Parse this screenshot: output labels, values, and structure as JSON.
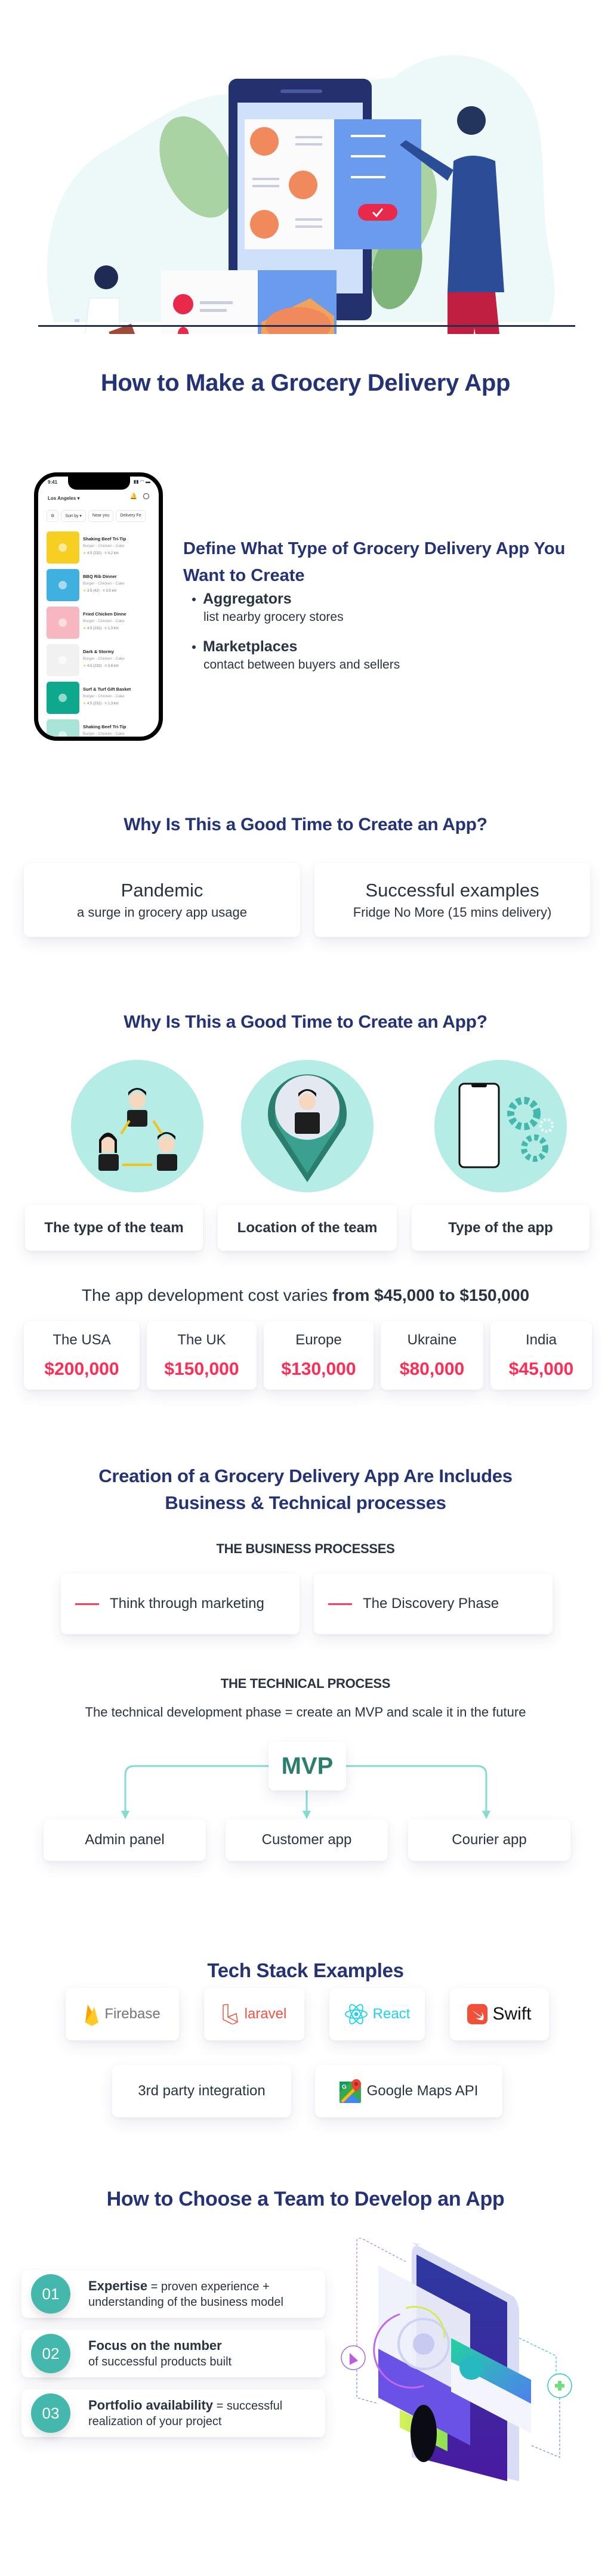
{
  "hero": {
    "illustration": "people-ordering-pizza-via-phone-app",
    "title": "How to Make a Grocery Delivery App"
  },
  "phone_mockup": {
    "time": "9:41",
    "status_icons": "signal wifi battery",
    "location": "Los Angeles ▾",
    "filters": [
      "Sort by ▾",
      "Near you",
      "Delivery Fe"
    ],
    "items": [
      {
        "name": "Shaking Beef Tri-Tip",
        "tags": "Burger - Chicken - Cake",
        "rating": "4.5",
        "reviews": "(232)",
        "distance": "4.2 km",
        "color": "#f7cf22"
      },
      {
        "name": "BBQ Rib Dinner",
        "tags": "Burger - Chicken - Cake",
        "rating": "3.5",
        "reviews": "(42)",
        "distance": "3.5 km",
        "color": "#3fb0e0"
      },
      {
        "name": "Fried Chicken Dinne",
        "tags": "Burger - Chicken - Cake",
        "rating": "4.5",
        "reviews": "(232)",
        "distance": "1.3 km",
        "color": "#f7b7c0"
      },
      {
        "name": "Dark & Stormy",
        "tags": "Burger - Chicken - Cake",
        "rating": "4.5",
        "reviews": "(232)",
        "distance": "3.8 km",
        "color": "#f1f1f1"
      },
      {
        "name": "Surf & Turf Gift Basket",
        "tags": "Burger - Chicken - Cake",
        "rating": "4.5",
        "reviews": "(232)",
        "distance": "1.3 km",
        "color": "#0ea88c"
      },
      {
        "name": "Shaking Beef Tri-Tip",
        "tags": "Burger - Chicken - Cake",
        "rating": "",
        "reviews": "",
        "distance": "",
        "color": "#a9e4d9"
      }
    ]
  },
  "define": {
    "heading": "Define What Type of Grocery Delivery App You Want to Create",
    "types": [
      {
        "title": "Aggregators",
        "desc": "list nearby grocery stores"
      },
      {
        "title": "Marketplaces",
        "desc": "contact between buyers and sellers"
      }
    ]
  },
  "why": {
    "heading": "Why Is This a Good Time to Create an App?",
    "cards": [
      {
        "title": "Pandemic",
        "desc": "a surge in grocery app usage"
      },
      {
        "title": "Successful examples",
        "desc": "Fridge No More (15 mins delivery)"
      }
    ]
  },
  "factors": {
    "heading": "Why Is This a Good Time to Create an App?",
    "items": [
      {
        "icon": "team-network-icon",
        "label": "The type of the team"
      },
      {
        "icon": "location-pin-person-icon",
        "label": "Location of the team"
      },
      {
        "icon": "phone-gears-icon",
        "label": "Type of the app"
      }
    ]
  },
  "cost": {
    "intro": "The app development cost varies ",
    "range": "from $45,000 to $150,000",
    "regions": [
      {
        "region": "The USA",
        "amount": "$200,000"
      },
      {
        "region": "The UK",
        "amount": "$150,000"
      },
      {
        "region": "Europe",
        "amount": "$130,000"
      },
      {
        "region": "Ukraine",
        "amount": "$80,000"
      },
      {
        "region": "India",
        "amount": "$45,000"
      }
    ],
    "accent": "#ff2d55"
  },
  "processes": {
    "heading_line1": "Creation of a Grocery Delivery App Are Includes",
    "heading_line2": "Business & Technical processes",
    "business_heading": "THE BUSINESS PROCESSES",
    "business": [
      "Think through marketing",
      "The Discovery Phase"
    ],
    "technical_heading": "THE TECHNICAL PROCESS",
    "technical_desc": "The technical development phase =  create an MVP and scale it in the future",
    "mvp": "MVP",
    "outputs": [
      "Admin panel",
      "Customer app",
      "Courier app"
    ]
  },
  "stack": {
    "heading": "Tech Stack Examples",
    "row1": [
      {
        "icon": "firebase-icon",
        "label": "Firebase",
        "color": "#757575"
      },
      {
        "icon": "laravel-icon",
        "label": "laravel",
        "color": "#f05340"
      },
      {
        "icon": "react-icon",
        "label": "React",
        "color": "#1ed3f0"
      },
      {
        "icon": "swift-icon",
        "label": "Swift",
        "color": "#111111"
      }
    ],
    "row2": [
      {
        "icon": "",
        "label": "3rd party integration",
        "color": "#2a3342"
      },
      {
        "icon": "google-maps-icon",
        "label": "Google Maps API",
        "color": "#2a3342"
      }
    ]
  },
  "choose": {
    "heading": "How to Choose a Team to Develop an App",
    "steps": [
      {
        "num": "01",
        "title": "Expertise",
        "rest": " = proven experience + understanding of the business model"
      },
      {
        "num": "02",
        "title": "Focus on the number",
        "rest": "of successful products built"
      },
      {
        "num": "03",
        "title": "Portfolio availability",
        "rest": " = successful realization of your project"
      }
    ],
    "illustration": "isometric-phone-app-interface"
  }
}
